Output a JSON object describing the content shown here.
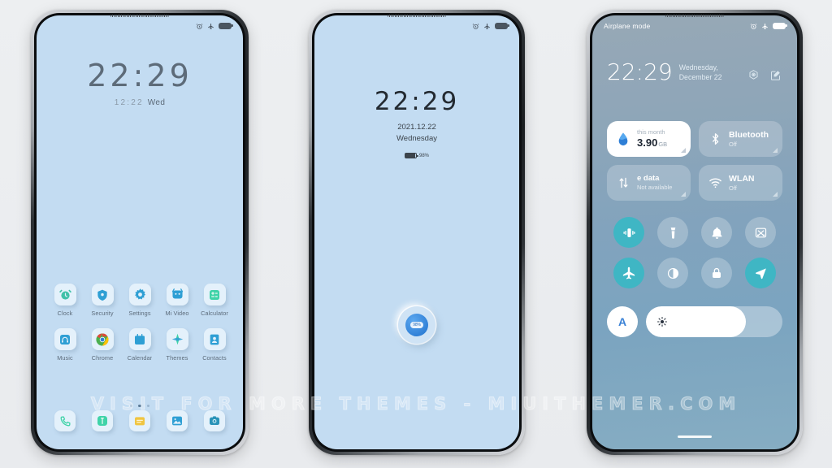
{
  "colors": {
    "wallpaper": "#c3dcf2",
    "accent_teal": "#3fb6c4",
    "accent_blue": "#2f7fd6",
    "cc_gradient_top": "#97a8b6",
    "cc_gradient_bottom": "#86adc2",
    "page_background": "#eceef0"
  },
  "watermark": {
    "text": "VISIT FOR MORE THEMES - MIUITHEMER.COM"
  },
  "phone1": {
    "name": "home-screen",
    "statusbar": {
      "icons": [
        "alarm-icon",
        "airplane-icon",
        "battery-icon"
      ]
    },
    "clock": {
      "time": "22:29",
      "date": "12:22",
      "weekday": "Wed"
    },
    "apps": [
      {
        "label": "Clock",
        "icon": "clock-icon"
      },
      {
        "label": "Security",
        "icon": "shield-icon"
      },
      {
        "label": "Settings",
        "icon": "gear-icon"
      },
      {
        "label": "Mi Video",
        "icon": "video-icon"
      },
      {
        "label": "Calculator",
        "icon": "calculator-icon"
      },
      {
        "label": "Music",
        "icon": "headphones-icon"
      },
      {
        "label": "Chrome",
        "icon": "chrome-icon"
      },
      {
        "label": "Calendar",
        "icon": "calendar-icon"
      },
      {
        "label": "Themes",
        "icon": "themes-icon"
      },
      {
        "label": "Contacts",
        "icon": "contacts-icon"
      }
    ],
    "page_dots": {
      "count": 3,
      "active_index": 1
    },
    "dock": [
      {
        "label": "Phone",
        "icon": "phone-icon"
      },
      {
        "label": "Messages",
        "icon": "message-icon"
      },
      {
        "label": "Notes",
        "icon": "notes-icon"
      },
      {
        "label": "Gallery",
        "icon": "gallery-icon"
      },
      {
        "label": "Camera",
        "icon": "camera-icon"
      }
    ]
  },
  "phone2": {
    "name": "lock-screen",
    "statusbar": {
      "icons": [
        "alarm-icon",
        "airplane-icon",
        "battery-icon"
      ]
    },
    "clock": {
      "time": "22:29",
      "date": "2021.12.22",
      "weekday": "Wednesday"
    },
    "battery": {
      "percent": "98%"
    },
    "fingerprint": {
      "label": "98%",
      "icon": "fingerprint-icon"
    }
  },
  "phone3": {
    "name": "control-center",
    "statusbar": {
      "label": "Airplane mode",
      "icons": [
        "alarm-icon",
        "airplane-icon",
        "battery-icon"
      ]
    },
    "header": {
      "time": "22:29",
      "date_line1": "Wednesday,",
      "date_line2": "December 22",
      "actions": [
        {
          "name": "settings-icon"
        },
        {
          "name": "edit-icon"
        }
      ]
    },
    "tiles": [
      {
        "name": "data-usage-tile",
        "icon": "water-drop-icon",
        "title": "this month",
        "value": "3.90",
        "unit": "GB",
        "style": "white"
      },
      {
        "name": "bluetooth-tile",
        "icon": "bluetooth-icon",
        "title": "Bluetooth",
        "sub": "Off",
        "style": "glass"
      },
      {
        "name": "mobile-data-tile",
        "icon": "data-arrows-icon",
        "title": "e data",
        "sub": "Not available",
        "style": "glass"
      },
      {
        "name": "wlan-tile",
        "icon": "wifi-icon",
        "title": "WLAN",
        "sub": "Off",
        "style": "glass"
      }
    ],
    "toggles": [
      {
        "name": "vibrate-toggle",
        "icon": "vibrate-icon",
        "active": true
      },
      {
        "name": "flashlight-toggle",
        "icon": "flashlight-icon",
        "active": false
      },
      {
        "name": "ringer-toggle",
        "icon": "bell-icon",
        "active": false
      },
      {
        "name": "screenshot-toggle",
        "icon": "scissors-icon",
        "active": false
      },
      {
        "name": "airplane-toggle",
        "icon": "airplane-icon",
        "active": true
      },
      {
        "name": "dark-mode-toggle",
        "icon": "contrast-icon",
        "active": false
      },
      {
        "name": "lock-toggle",
        "icon": "lock-icon",
        "active": false
      },
      {
        "name": "location-toggle",
        "icon": "navigation-icon",
        "active": true
      }
    ],
    "brightness": {
      "auto_label": "A",
      "icon": "sun-icon",
      "value_percent": 73
    }
  }
}
